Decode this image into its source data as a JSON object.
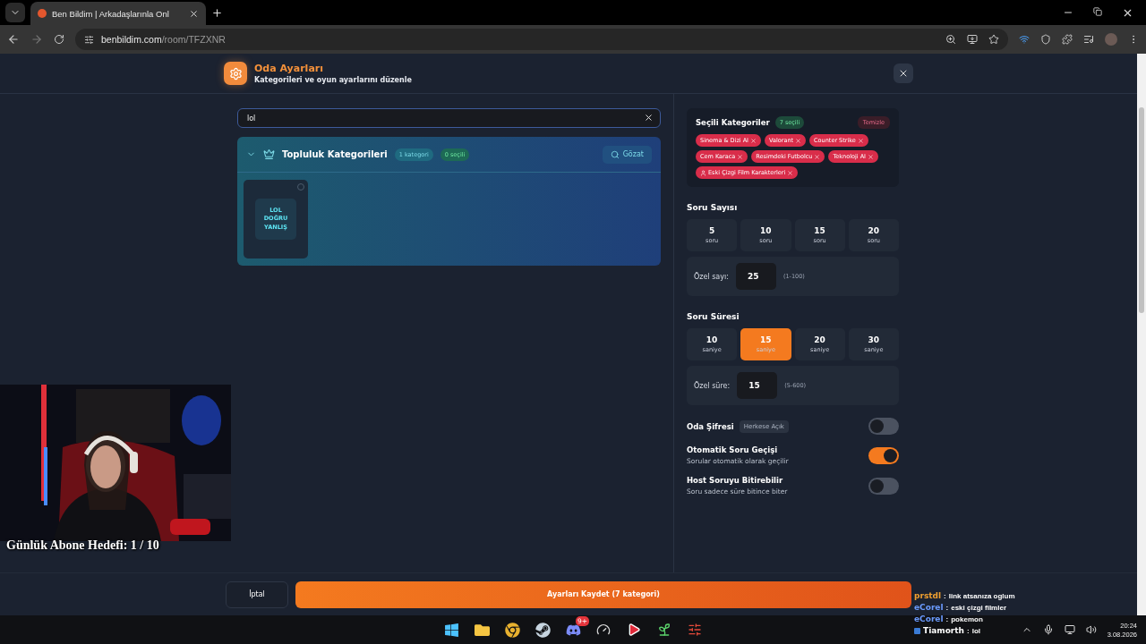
{
  "browser": {
    "tab_title": "Ben Bildim | Arkadaşlarınla Onl",
    "url_host": "benbildim.com",
    "url_path": "/room/TFZXNR"
  },
  "header": {
    "title": "Oda Ayarları",
    "subtitle": "Kategorileri ve oyun ayarlarını düzenle"
  },
  "search": {
    "value": "lol"
  },
  "community": {
    "title": "Topluluk Kategorileri",
    "count": "1 kategori",
    "selected_count": "0 seçili",
    "browse": "Gözat",
    "expanded": true,
    "cards": [
      {
        "lines": [
          "LOL",
          "DOĞRU",
          "YANLIŞ"
        ],
        "selected": false
      }
    ]
  },
  "selected_categories": {
    "title": "Seçili Kategoriler",
    "count": "7 seçili",
    "clear": "Temizle",
    "tags": [
      {
        "label": "Sinema & Dizi AI",
        "kind": "plain"
      },
      {
        "label": "Valorant",
        "kind": "plain"
      },
      {
        "label": "Counter Strike",
        "kind": "plain"
      },
      {
        "label": "Cem Karaca",
        "kind": "plain"
      },
      {
        "label": "Resimdeki Futbolcu",
        "kind": "plain"
      },
      {
        "label": "Teknoloji AI",
        "kind": "plain"
      },
      {
        "label": "Eski Çizgi Film Karakterleri",
        "kind": "user"
      }
    ]
  },
  "question_count": {
    "title": "Soru Sayısı",
    "options": [
      {
        "value": "5",
        "unit": "soru",
        "selected": false
      },
      {
        "value": "10",
        "unit": "soru",
        "selected": false
      },
      {
        "value": "15",
        "unit": "soru",
        "selected": false
      },
      {
        "value": "20",
        "unit": "soru",
        "selected": false
      }
    ],
    "custom": {
      "label": "Özel sayı:",
      "value": "25",
      "range": "(1-100)"
    }
  },
  "question_time": {
    "title": "Soru Süresi",
    "options": [
      {
        "value": "10",
        "unit": "saniye",
        "selected": false
      },
      {
        "value": "15",
        "unit": "saniye",
        "selected": true
      },
      {
        "value": "20",
        "unit": "saniye",
        "selected": false
      },
      {
        "value": "30",
        "unit": "saniye",
        "selected": false
      }
    ],
    "custom": {
      "label": "Özel süre:",
      "value": "15",
      "range": "(5-600)"
    }
  },
  "toggles": [
    {
      "title": "Oda Şifresi",
      "badge": "Herkese Açık",
      "on": false
    },
    {
      "title": "Otomatik Soru Geçişi",
      "description": "Sorular otomatik olarak geçilir",
      "on": true
    },
    {
      "title": "Host Soruyu Bitirebilir",
      "description": "Soru sadece süre bitince biter",
      "on": false
    }
  ],
  "footer": {
    "cancel": "İptal",
    "save": "Ayarları Kaydet (7 kategori)"
  },
  "stream_overlay": {
    "goal": "Günlük Abone Hedefi: 1 / 10",
    "chat": [
      {
        "user": "prstdl",
        "separator": ":",
        "message": "link atsanıza oglum",
        "color": "#f0a030",
        "kind": "plain"
      },
      {
        "user": "eCorel",
        "separator": ":",
        "message": "eski çizgi filmler",
        "color": "#6b9bff",
        "kind": "plain"
      },
      {
        "user": "eCorel",
        "separator": ":",
        "message": "pokemon",
        "color": "#6b9bff",
        "kind": "plain"
      },
      {
        "user": "Tiamorth",
        "separator": ":",
        "message": "lol",
        "color": "#ffffff",
        "kind": "badge"
      }
    ]
  },
  "taskbar": {
    "apps": [
      {
        "kind": "windows"
      },
      {
        "kind": "folder"
      },
      {
        "kind": "chrome"
      },
      {
        "kind": "steam"
      },
      {
        "kind": "discord",
        "badge": "9+"
      },
      {
        "kind": "dial"
      },
      {
        "kind": "player"
      },
      {
        "kind": "leaf"
      },
      {
        "kind": "mixer"
      }
    ],
    "time": "20:24",
    "date": "3.08.2026"
  }
}
